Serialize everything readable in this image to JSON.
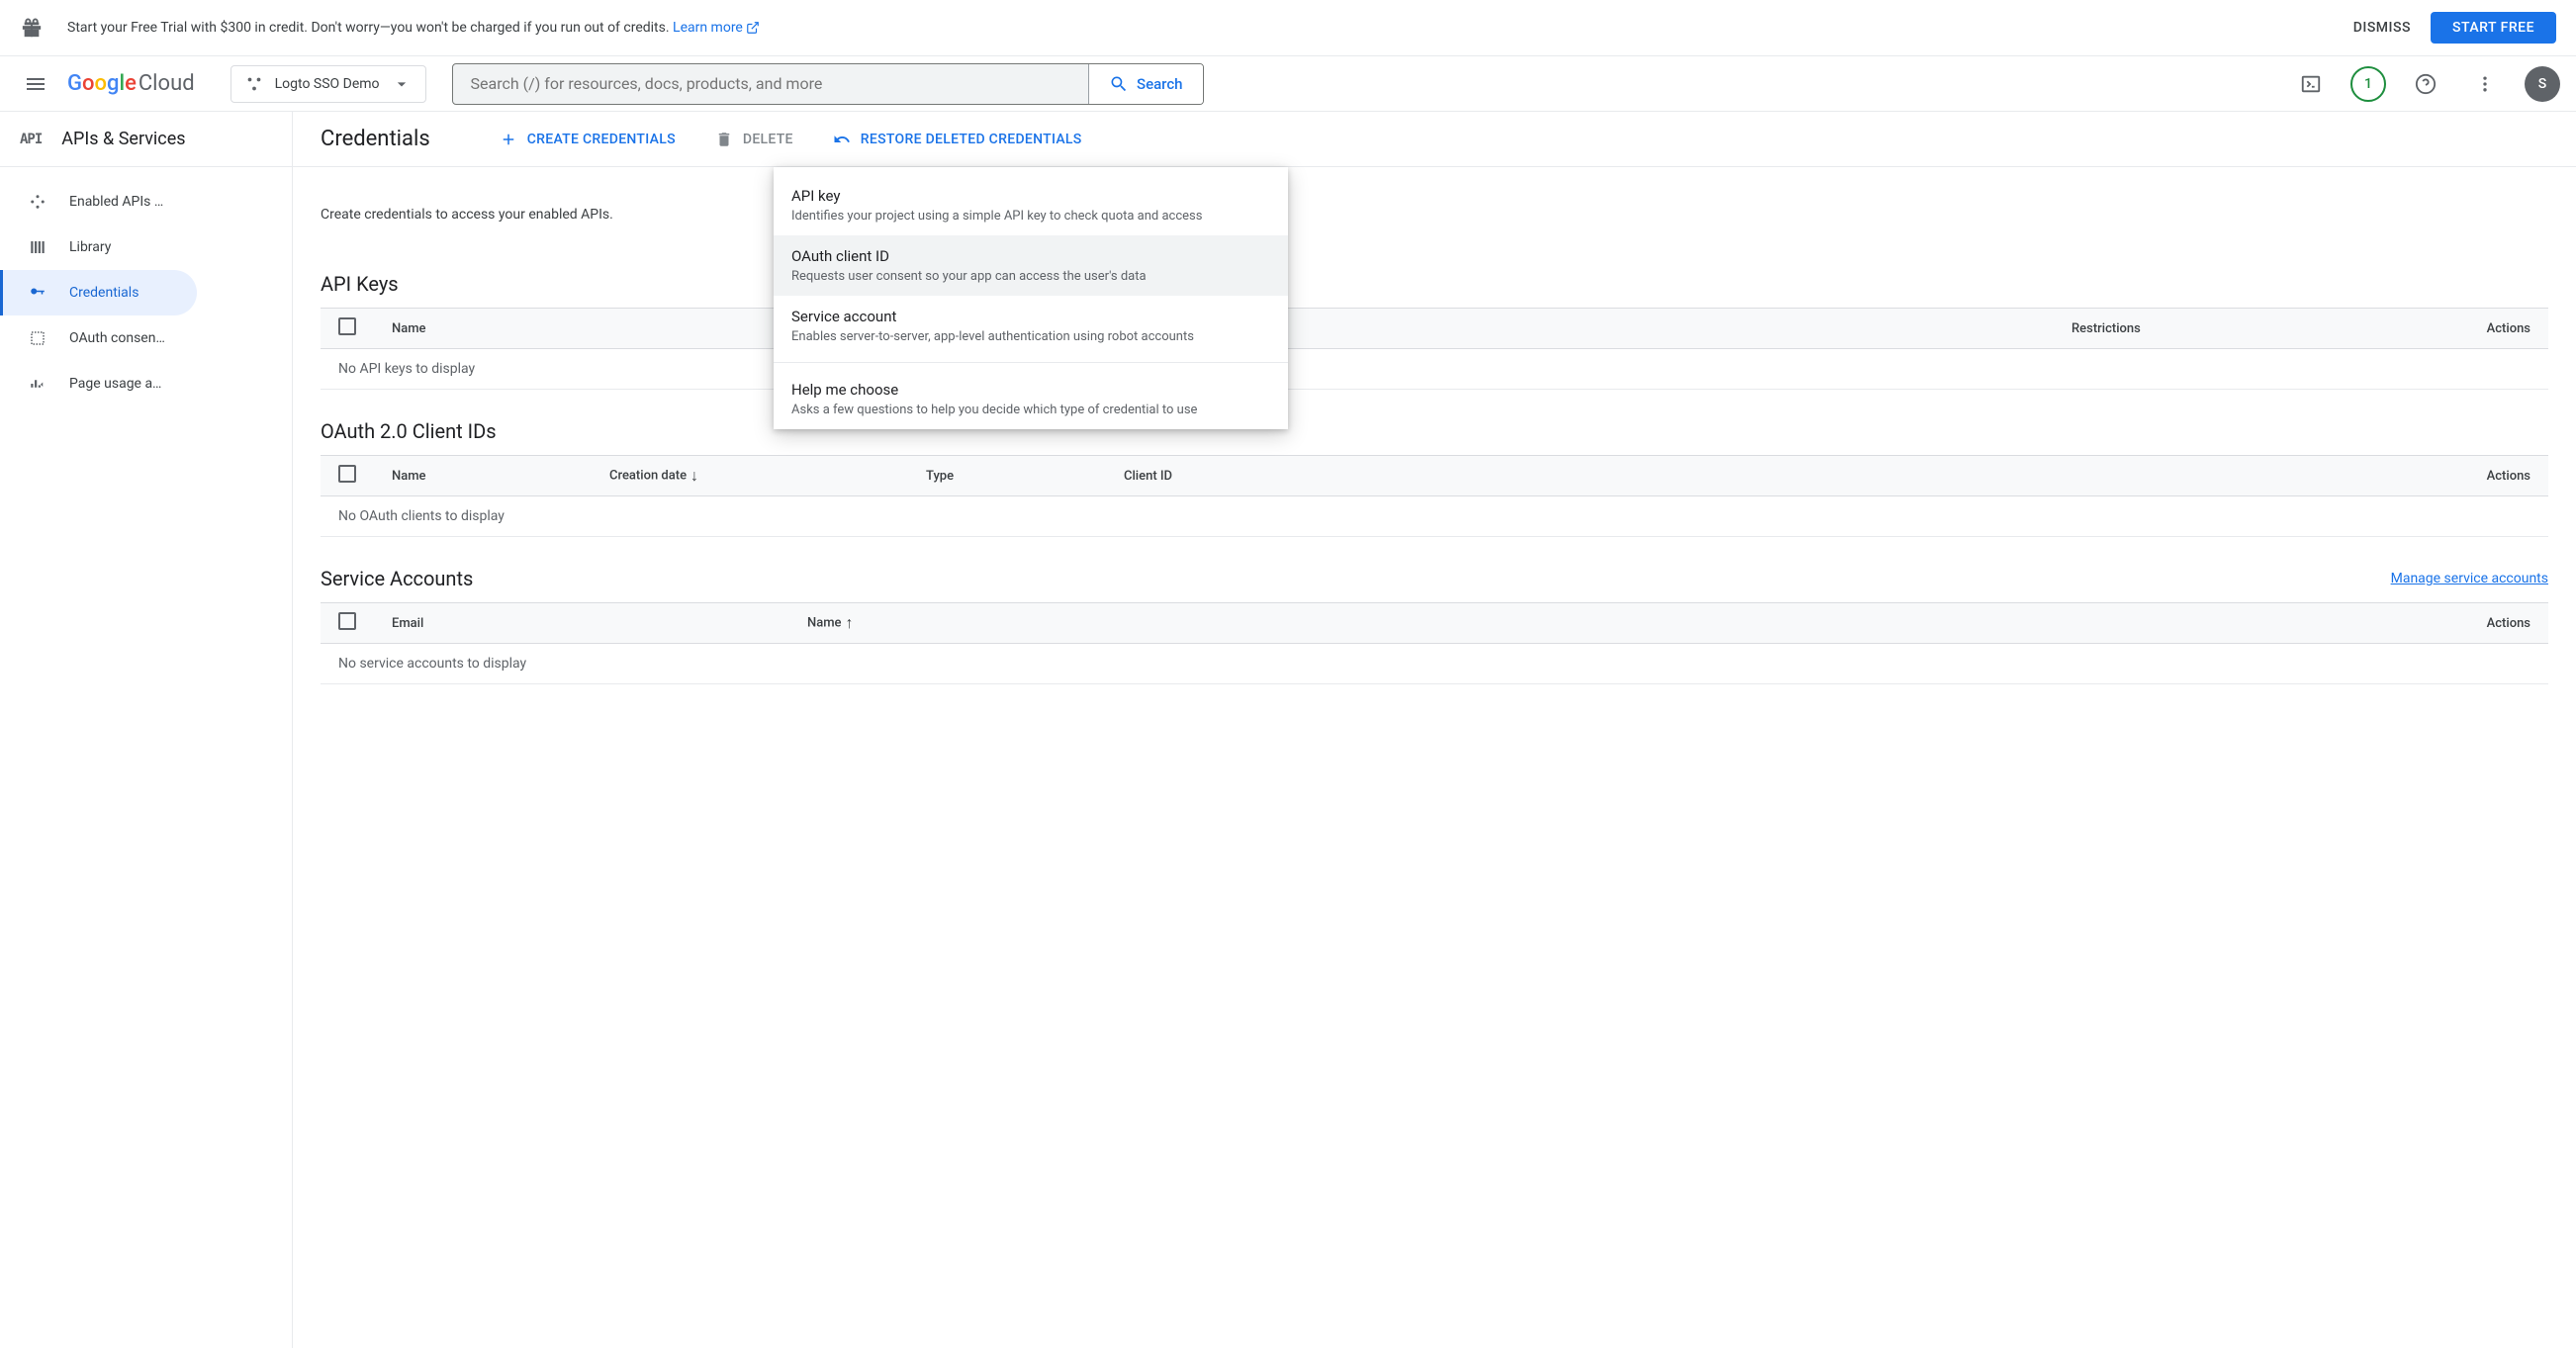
{
  "banner": {
    "text": "Start your Free Trial with $300 in credit. Don't worry—you won't be charged if you run out of credits. ",
    "link": "Learn more",
    "dismiss": "DISMISS",
    "start_free": "START FREE"
  },
  "header": {
    "logo_cloud": "Cloud",
    "project": "Logto SSO Demo",
    "search_placeholder": "Search (/) for resources, docs, products, and more",
    "search_btn": "Search",
    "notif_count": "1",
    "avatar_initial": "S"
  },
  "sidebar": {
    "api_badge": "API",
    "title": "APIs & Services",
    "items": [
      {
        "label": "Enabled APIs …"
      },
      {
        "label": "Library"
      },
      {
        "label": "Credentials"
      },
      {
        "label": "OAuth consen…"
      },
      {
        "label": "Page usage a…"
      }
    ]
  },
  "page": {
    "title": "Credentials",
    "create": "CREATE CREDENTIALS",
    "delete": "DELETE",
    "restore": "RESTORE DELETED CREDENTIALS",
    "intro": "Create credentials to access your enabled APIs."
  },
  "dropdown": {
    "api_key_t": "API key",
    "api_key_s": "Identifies your project using a simple API key to check quota and access",
    "oauth_t": "OAuth client ID",
    "oauth_s": "Requests user consent so your app can access the user's data",
    "service_t": "Service account",
    "service_s": "Enables server-to-server, app-level authentication using robot accounts",
    "help_t": "Help me choose",
    "help_s": "Asks a few questions to help you decide which type of credential to use"
  },
  "sections": {
    "api_keys": {
      "title": "API Keys",
      "cols": {
        "name": "Name",
        "restrictions": "Restrictions",
        "actions": "Actions"
      },
      "empty": "No API keys to display"
    },
    "oauth": {
      "title": "OAuth 2.0 Client IDs",
      "cols": {
        "name": "Name",
        "creation": "Creation date",
        "type": "Type",
        "client_id": "Client ID",
        "actions": "Actions"
      },
      "empty": "No OAuth clients to display"
    },
    "service": {
      "title": "Service Accounts",
      "manage_link": "Manage service accounts",
      "cols": {
        "email": "Email",
        "name": "Name",
        "actions": "Actions"
      },
      "empty": "No service accounts to display"
    }
  }
}
